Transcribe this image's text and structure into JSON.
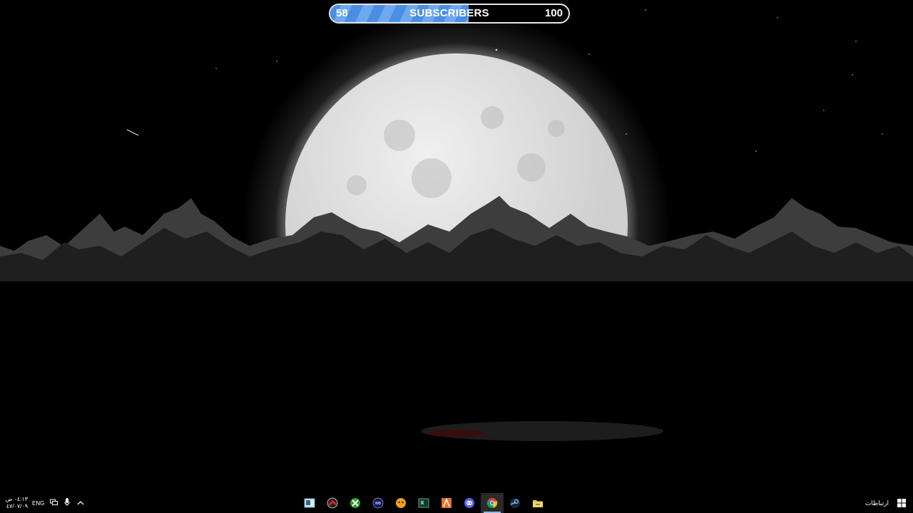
{
  "subscriber_bar": {
    "current": "58",
    "label": "SUBSCRIBERS",
    "target": "100",
    "progress_fraction": 0.58
  },
  "taskbar": {
    "time": "٠٤:١٣ ص",
    "date": "٤٧/٠٧/٠٩",
    "language": "ENG",
    "contacts_label": "ارتباطات",
    "apps": [
      {
        "name": "photo-viewer-icon",
        "active": false
      },
      {
        "name": "red-app-icon",
        "active": false
      },
      {
        "name": "xbox-icon",
        "active": false
      },
      {
        "name": "blue-dial-icon",
        "active": false
      },
      {
        "name": "orange-game-icon",
        "active": false
      },
      {
        "name": "terminal-icon",
        "active": false
      },
      {
        "name": "orange-a-app-icon",
        "active": false
      },
      {
        "name": "discord-icon",
        "active": false
      },
      {
        "name": "chrome-icon",
        "active": true
      },
      {
        "name": "steam-icon",
        "active": false
      },
      {
        "name": "file-explorer-icon",
        "active": false
      }
    ]
  },
  "colors": {
    "bar_fill": "#4a8fe0",
    "bar_border": "#e6e6e6",
    "moon": "#dcdcdc",
    "taskbar": "#000000"
  }
}
